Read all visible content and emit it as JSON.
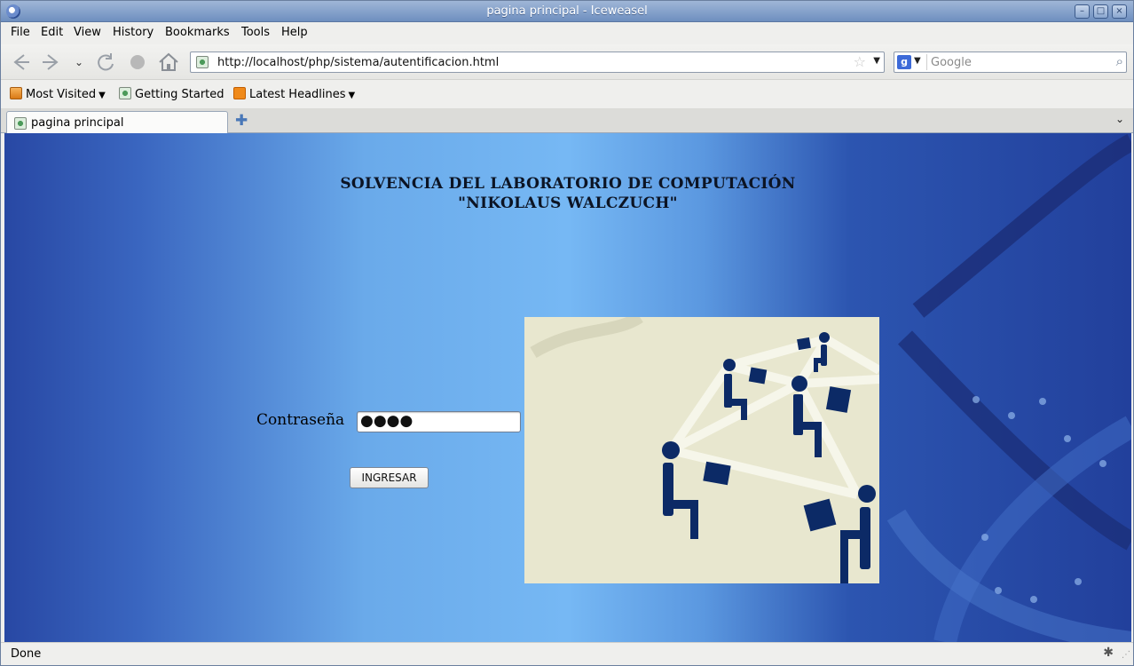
{
  "window": {
    "title": "pagina principal - Iceweasel"
  },
  "menu": [
    "File",
    "Edit",
    "View",
    "History",
    "Bookmarks",
    "Tools",
    "Help"
  ],
  "navigation": {
    "url": "http://localhost/php/sistema/autentificacion.html"
  },
  "search": {
    "placeholder": "Google"
  },
  "bookmarks": [
    {
      "label": "Most Visited",
      "icon": "folder-icon",
      "dropdown": true
    },
    {
      "label": "Getting Started",
      "icon": "page-icon",
      "dropdown": false
    },
    {
      "label": "Latest Headlines",
      "icon": "rss-icon",
      "dropdown": true
    }
  ],
  "tabs": [
    {
      "label": "pagina principal"
    }
  ],
  "page": {
    "heading_line1": "SOLVENCIA DEL LABORATORIO DE COMPUTACIÓN",
    "heading_line2": "\"NIKOLAUS WALCZUCH\"",
    "password_label": "Contraseña",
    "password_value": "●●●●",
    "submit_label": "INGRESAR"
  },
  "status": {
    "text": "Done"
  },
  "colors": {
    "content_dark": "#2848a4",
    "content_light": "#76b8f4",
    "illustration_bg": "#e8e7cf",
    "figure_navy": "#0c2a66"
  }
}
